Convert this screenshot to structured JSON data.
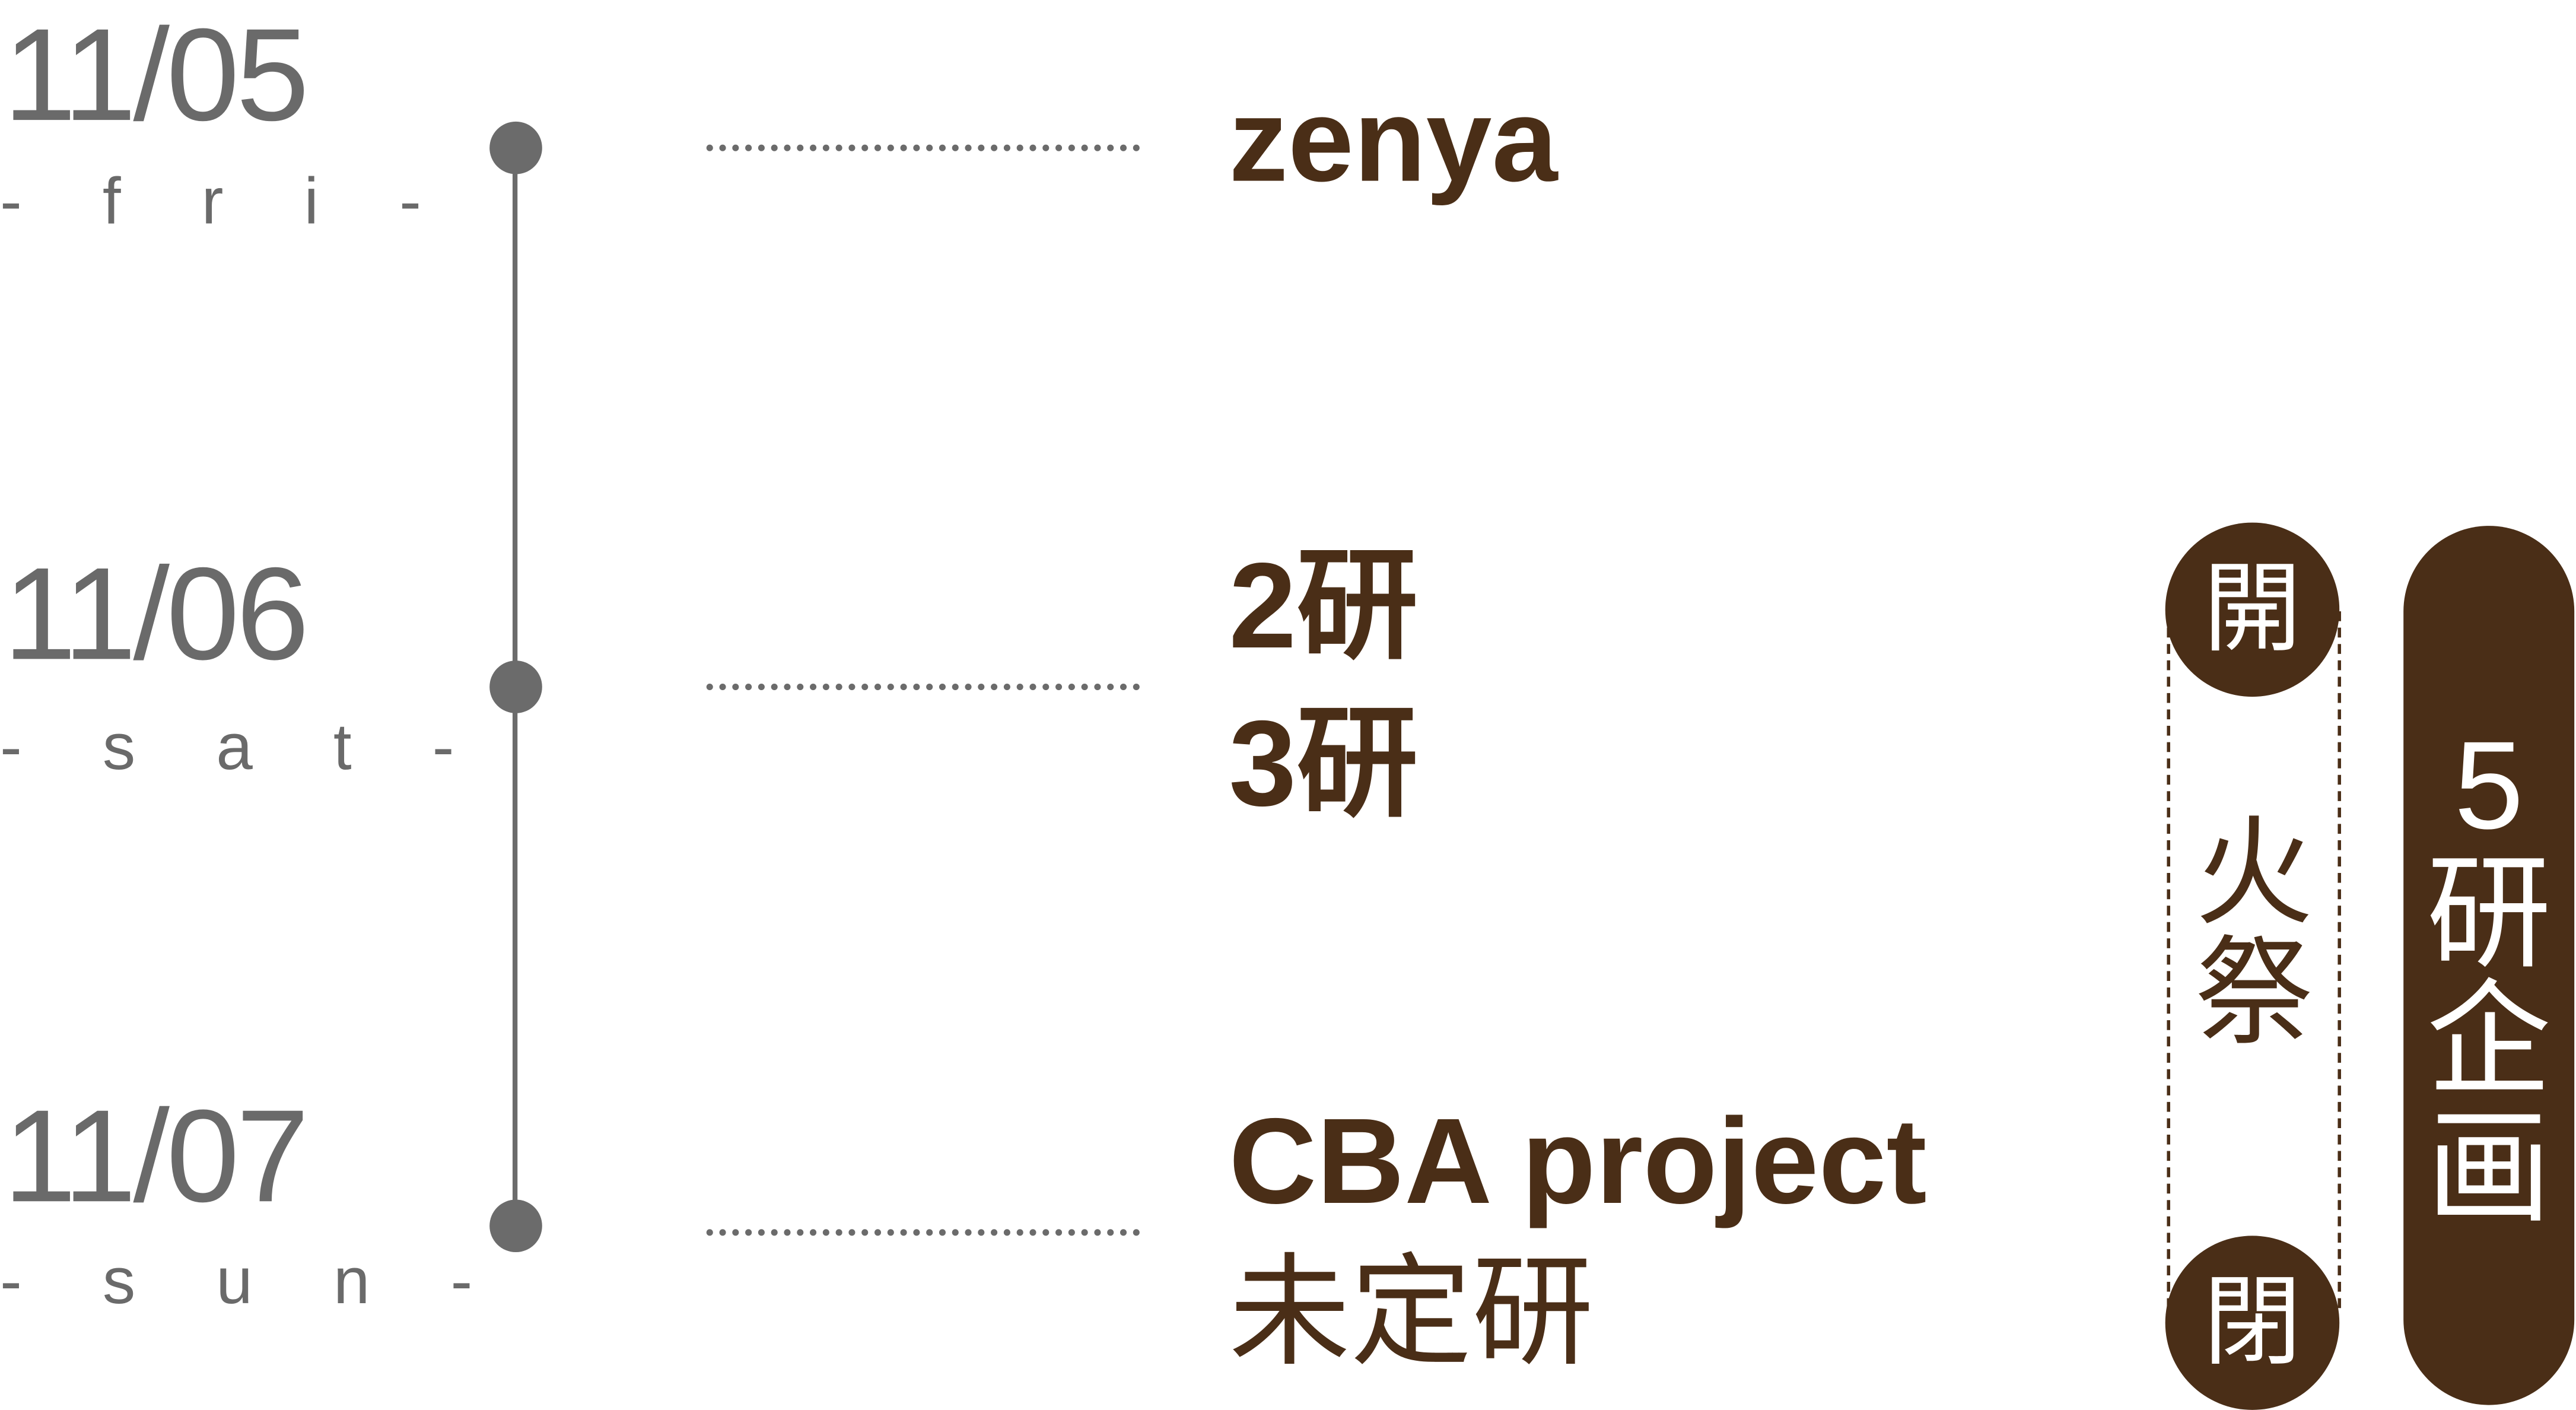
{
  "timeline": [
    {
      "date": "11/05",
      "day": "- f r i -",
      "events": [
        "zenya"
      ]
    },
    {
      "date": "11/06",
      "day": "- s a t -",
      "events": [
        "2研",
        "3研"
      ]
    },
    {
      "date": "11/07",
      "day": "- s u n -",
      "events": [
        "CBA project",
        "未定研"
      ]
    }
  ],
  "fire_festival": {
    "open_label": "開",
    "close_label": "閉",
    "title_chars": [
      "火",
      "祭"
    ]
  },
  "side_banner": {
    "chars": [
      "5",
      "研",
      "企",
      "画"
    ]
  },
  "colors": {
    "timeline_gray": "#6b6b6b",
    "accent_brown": "#4a2e17",
    "background": "#ffffff"
  }
}
